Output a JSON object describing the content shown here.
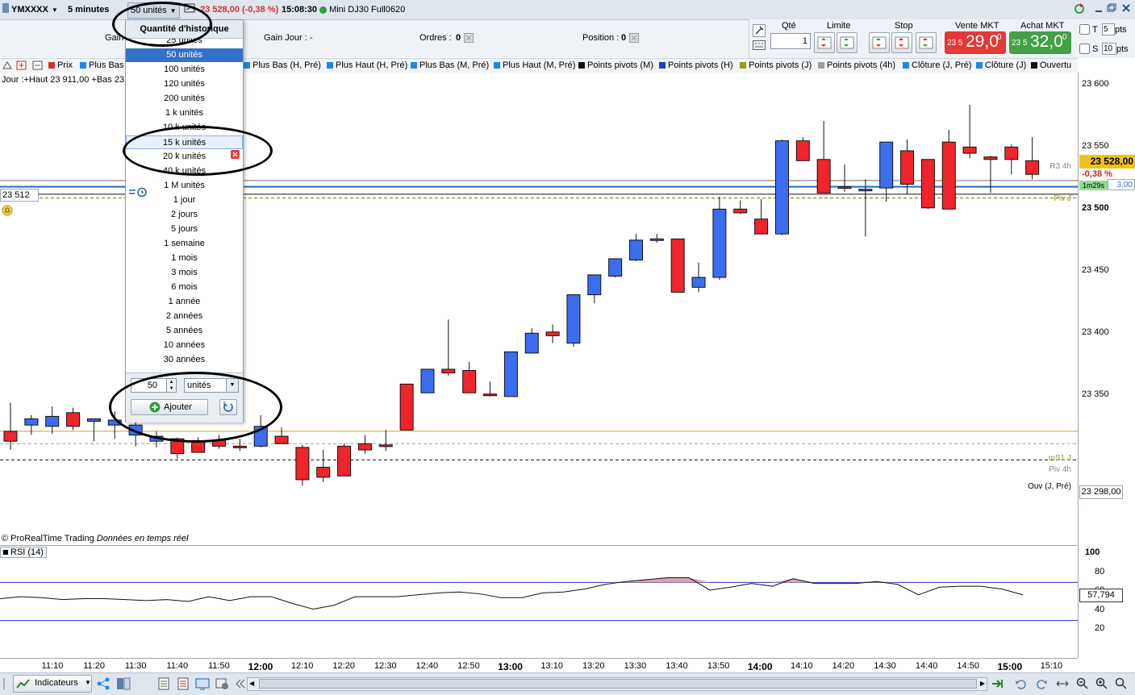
{
  "toolbar": {
    "symbol": "YMXXXX",
    "timeframe": "5 minutes",
    "units": "50 unités",
    "price": "23 528,00",
    "change": "(-0,38 %)",
    "time": "15:08:30",
    "instrument": "Mini DJ30 Full0620"
  },
  "row2": {
    "gain_label": "Gain",
    "gain_day_label": "Gain Jour :",
    "gain_day_value": "-",
    "orders_label": "Ordres :",
    "orders_value": "0",
    "position_label": "Position :",
    "position_value": "0"
  },
  "order_panel": {
    "qty_label": "Qté",
    "qty_value": "1",
    "limit_label": "Limite",
    "stop_label": "Stop",
    "sell_label": "Vente MKT",
    "buy_label": "Achat MKT",
    "sell_prefix": "23 5",
    "sell_big": "29,0",
    "sell_sup": "0",
    "buy_prefix": "23 5",
    "buy_big": "32,0",
    "buy_sup": "0",
    "t_label": "T",
    "t_value": "5",
    "s_label": "S",
    "s_value": "10",
    "pts": "pts",
    "sell_color": "#e53935",
    "buy_color": "#43a047"
  },
  "legend": [
    {
      "label": "Prix",
      "color": "#d32f2f"
    },
    {
      "label": "Plus Bas",
      "color": "#1e88e5"
    },
    {
      "label": "Plus Bas (H, Pré)",
      "color": "#1e88e5"
    },
    {
      "label": "Plus Haut (H, Pré)",
      "color": "#1e88e5"
    },
    {
      "label": "Plus Bas (M, Pré)",
      "color": "#1e88e5"
    },
    {
      "label": "Plus Haut (M, Pré)",
      "color": "#1e88e5"
    },
    {
      "label": "Points pivots (M)",
      "color": "#111111"
    },
    {
      "label": "Points pivots (H)",
      "color": "#1a3fb5"
    },
    {
      "label": "Points pivots (J)",
      "color": "#9a9a22"
    },
    {
      "label": "Points pivots (4h)",
      "color": "#9e9e9e"
    },
    {
      "label": "Clôture (J, Pré)",
      "color": "#1e88e5"
    },
    {
      "label": "Clôture (J)",
      "color": "#1e88e5"
    },
    {
      "label": "Ouvertu",
      "color": "#111111"
    }
  ],
  "chart_header": "Jour :+Haut 23 911,00 +Bas 23",
  "level_left_label": "23 512",
  "dropdown": {
    "header": "Quantité d'historique",
    "options": [
      "25 unités",
      "50 unités",
      "100 unités",
      "120 unités",
      "200 unités",
      "1 k unités",
      "10 k unités",
      "15 k unités",
      "20 k unités",
      "40 k unités",
      "1 M unités",
      "1 jour",
      "2 jours",
      "5 jours",
      "1 semaine",
      "1 mois",
      "3 mois",
      "6 mois",
      "1 année",
      "2 années",
      "5 années",
      "10 années",
      "30 années"
    ],
    "selected": "50 unités",
    "custom_value": "50",
    "custom_unit": "unités",
    "add_label": "Ajouter"
  },
  "price_axis": {
    "labels": [
      "23 600",
      "23 550",
      "23 500",
      "23 450",
      "23 400",
      "23 350"
    ],
    "current_price": "23 528,00",
    "current_change": "-0,38 %",
    "countdown": "1m29s",
    "hidden_tag": "3,00",
    "open_tag": "23 298,00"
  },
  "level_labels": {
    "r3": "R3 4h",
    "piv_j": "Piv J",
    "ms1": "mS1 J",
    "piv4h": "Piv 4h",
    "ouv": "Ouv (J, Pré)"
  },
  "footer_text": {
    "copyright": "© ProRealTime Trading",
    "realtime": "Données en temps réel"
  },
  "rsi": {
    "label": "RSI (14)",
    "value": "57,794",
    "axis": [
      "100",
      "80",
      "60",
      "40",
      "20"
    ],
    "levels": [
      70,
      30
    ],
    "values": [
      53,
      55,
      54,
      52,
      53,
      53,
      52,
      51,
      52,
      50,
      55,
      51,
      55,
      55,
      48,
      42,
      46,
      55,
      55,
      55,
      57,
      59,
      60,
      58,
      54,
      54,
      59,
      60,
      63,
      68,
      71,
      73,
      75,
      75,
      62,
      65,
      69,
      66,
      74,
      69,
      69,
      69,
      71,
      68,
      57,
      65,
      66,
      66,
      63,
      57
    ]
  },
  "time_axis": [
    "11:10",
    "11:20",
    "11:30",
    "11:40",
    "11:50",
    "12:00",
    "12:10",
    "12:20",
    "12:30",
    "12:40",
    "12:50",
    "13:00",
    "13:10",
    "13:20",
    "13:30",
    "13:40",
    "13:50",
    "14:00",
    "14:10",
    "14:20",
    "14:30",
    "14:40",
    "14:50",
    "15:00",
    "15:10"
  ],
  "time_axis_bold": [
    "12:00",
    "13:00",
    "14:00",
    "15:00"
  ],
  "bottom_bar": {
    "indicators": "Indicateurs"
  },
  "chart_data": {
    "type": "candlestick",
    "ylim": [
      23230,
      23610
    ],
    "levels": {
      "r3_4h": 23523,
      "piv_j": 23509,
      "ms1_j": 23321,
      "piv_4h": 23311,
      "ouv_j_pre": 23298,
      "blue": 23518,
      "black_j": 23512
    },
    "candles": [
      [
        23321,
        23344,
        23306,
        23313
      ],
      [
        23326,
        23334,
        23318,
        23331
      ],
      [
        23325,
        23341,
        23319,
        23333
      ],
      [
        23336,
        23340,
        23322,
        23325
      ],
      [
        23329,
        23331,
        23313,
        23331
      ],
      [
        23326,
        23337,
        23315,
        23330
      ],
      [
        23318,
        23335,
        23309,
        23326
      ],
      [
        23313,
        23321,
        23308,
        23317
      ],
      [
        23315,
        23316,
        23299,
        23303
      ],
      [
        23313,
        23316,
        23305,
        23304
      ],
      [
        23314,
        23318,
        23307,
        23309
      ],
      [
        23309,
        23315,
        23305,
        23308
      ],
      [
        23309,
        23334,
        23308,
        23325
      ],
      [
        23317,
        23324,
        23312,
        23311
      ],
      [
        23308,
        23310,
        23277,
        23282
      ],
      [
        23292,
        23306,
        23280,
        23284
      ],
      [
        23309,
        23311,
        23285,
        23285
      ],
      [
        23311,
        23318,
        23303,
        23306
      ],
      [
        23310,
        23322,
        23305,
        23309
      ],
      [
        23359,
        23359,
        23322,
        23322
      ],
      [
        23352,
        23356,
        23352,
        23371
      ],
      [
        23371,
        23411,
        23366,
        23368
      ],
      [
        23370,
        23377,
        23352,
        23352
      ],
      [
        23351,
        23361,
        23349,
        23350
      ],
      [
        23349,
        23384,
        23349,
        23385
      ],
      [
        23384,
        23404,
        23384,
        23400
      ],
      [
        23401,
        23407,
        23392,
        23398
      ],
      [
        23392,
        23418,
        23389,
        23431
      ],
      [
        23431,
        23446,
        23424,
        23447
      ],
      [
        23446,
        23459,
        23445,
        23460
      ],
      [
        23459,
        23480,
        23458,
        23475
      ],
      [
        23476,
        23480,
        23473,
        23476
      ],
      [
        23476,
        23476,
        23433,
        23433
      ],
      [
        23437,
        23457,
        23433,
        23445
      ],
      [
        23445,
        23510,
        23443,
        23500
      ],
      [
        23500,
        23507,
        23496,
        23497
      ],
      [
        23492,
        23508,
        23488,
        23480
      ],
      [
        23480,
        23556,
        23479,
        23555
      ],
      [
        23555,
        23558,
        23539,
        23539
      ],
      [
        23540,
        23571,
        23533,
        23513
      ],
      [
        23518,
        23536,
        23514,
        23517
      ],
      [
        23516,
        23524,
        23478,
        23516
      ],
      [
        23517,
        23552,
        23506,
        23554
      ],
      [
        23547,
        23556,
        23512,
        23520
      ],
      [
        23540,
        23529,
        23500,
        23501
      ],
      [
        23554,
        23564,
        23500,
        23500
      ],
      [
        23550,
        23584,
        23541,
        23545
      ],
      [
        23542,
        23543,
        23513,
        23540
      ],
      [
        23550,
        23552,
        23528,
        23540
      ],
      [
        23539,
        23558,
        23524,
        23528
      ]
    ]
  }
}
